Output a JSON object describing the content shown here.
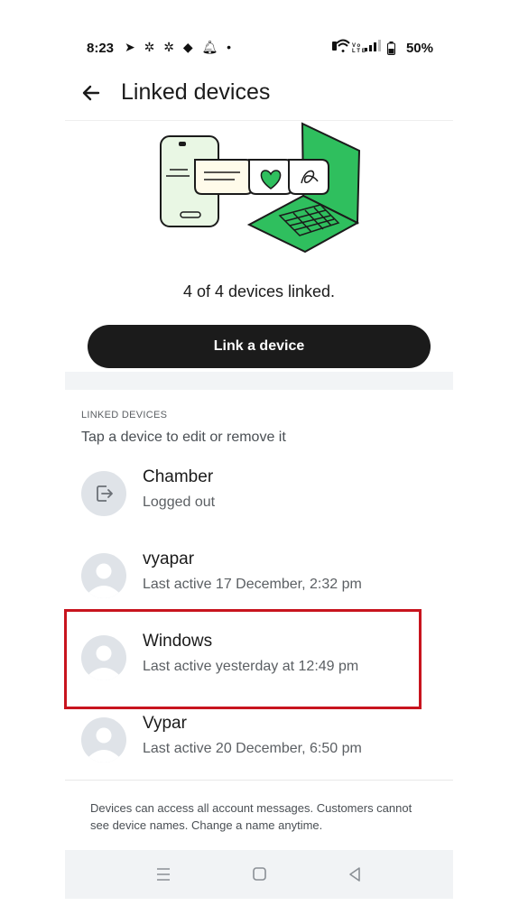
{
  "status_bar": {
    "time": "8:23",
    "battery": "50%"
  },
  "header": {
    "title": "Linked devices"
  },
  "summary": "4 of 4 devices linked.",
  "link_button": "Link a device",
  "section": {
    "header": "LINKED DEVICES",
    "subtitle": "Tap a device to edit or remove it"
  },
  "devices": [
    {
      "name": "Chamber",
      "status": "Logged out",
      "icon": "logout-icon"
    },
    {
      "name": "vyapar",
      "status": "Last active 17 December, 2:32 pm",
      "icon": "person-icon"
    },
    {
      "name": "Windows",
      "status": "Last active yesterday at 12:49 pm",
      "icon": "person-icon"
    },
    {
      "name": "Vypar",
      "status": "Last active 20 December, 6:50 pm",
      "icon": "person-icon"
    }
  ],
  "footer_note": "Devices can access all account messages. Customers cannot see device names. Change a name anytime.",
  "colors": {
    "accent": "#22c55e",
    "button": "#1b1b1b",
    "highlight": "#c8141e"
  }
}
